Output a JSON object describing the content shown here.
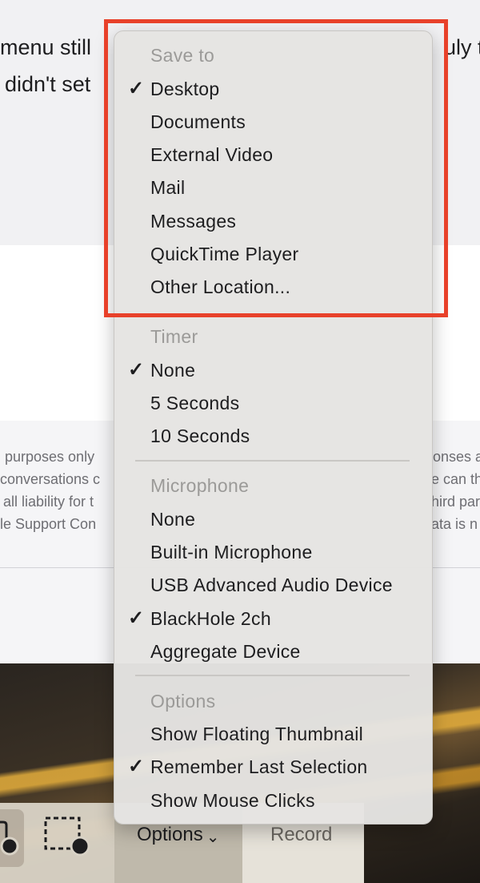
{
  "background": {
    "line1": "menu still",
    "line1_right": "uly t",
    "line2": "didn't set",
    "disclaimer_left": [
      " purposes only",
      "conversations c",
      " all liability for t",
      "le Support Con"
    ],
    "disclaimer_right": [
      "onses a",
      "e can th",
      "hird par",
      "ata is n"
    ]
  },
  "menu": {
    "save_to": {
      "header": "Save to",
      "items": [
        {
          "label": "Desktop",
          "checked": true
        },
        {
          "label": "Documents",
          "checked": false
        },
        {
          "label": "External Video",
          "checked": false
        },
        {
          "label": "Mail",
          "checked": false
        },
        {
          "label": "Messages",
          "checked": false
        },
        {
          "label": "QuickTime Player",
          "checked": false
        },
        {
          "label": "Other Location...",
          "checked": false
        }
      ]
    },
    "timer": {
      "header": "Timer",
      "items": [
        {
          "label": "None",
          "checked": true
        },
        {
          "label": "5 Seconds",
          "checked": false
        },
        {
          "label": "10 Seconds",
          "checked": false
        }
      ]
    },
    "microphone": {
      "header": "Microphone",
      "items": [
        {
          "label": "None",
          "checked": false
        },
        {
          "label": "Built-in Microphone",
          "checked": false
        },
        {
          "label": "USB Advanced Audio Device",
          "checked": false
        },
        {
          "label": "BlackHole 2ch",
          "checked": true
        },
        {
          "label": "Aggregate Device",
          "checked": false
        }
      ]
    },
    "options": {
      "header": "Options",
      "items": [
        {
          "label": "Show Floating Thumbnail",
          "checked": false
        },
        {
          "label": "Remember Last Selection",
          "checked": true
        },
        {
          "label": "Show Mouse Clicks",
          "checked": false
        }
      ]
    },
    "check_glyph": "✓"
  },
  "toolbar": {
    "options_label": "Options",
    "chevron": "⌄",
    "record_label": "Record"
  },
  "colors": {
    "highlight_border": "#e8412a"
  }
}
